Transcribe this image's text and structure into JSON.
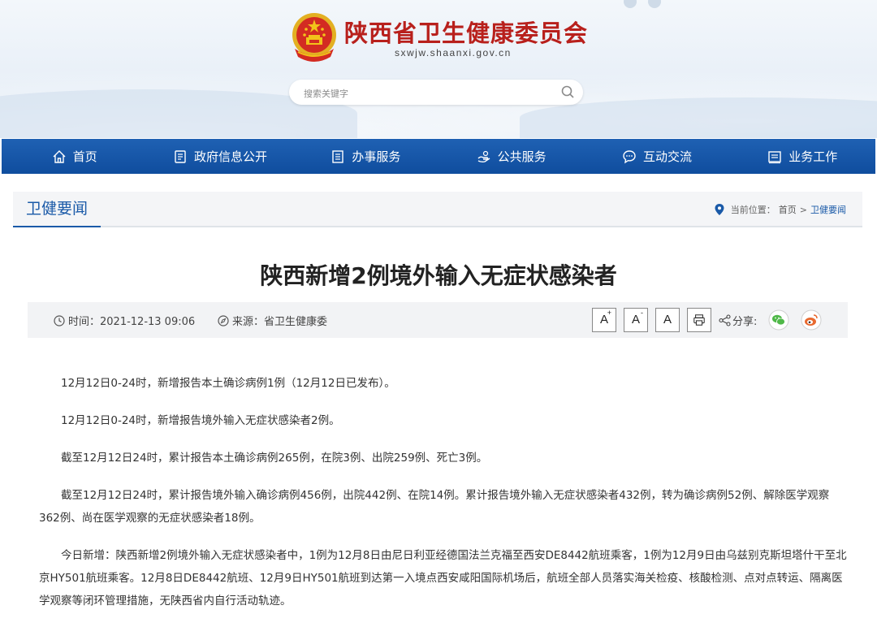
{
  "header": {
    "title": "陕西省卫生健康委员会",
    "url": "sxwjw.shaanxi.gov.cn",
    "search_placeholder": "搜索关键字"
  },
  "nav": {
    "items": [
      {
        "label": "首页",
        "icon": "home-icon"
      },
      {
        "label": "政府信息公开",
        "icon": "document-icon"
      },
      {
        "label": "办事服务",
        "icon": "list-icon"
      },
      {
        "label": "公共服务",
        "icon": "service-icon"
      },
      {
        "label": "互动交流",
        "icon": "chat-icon"
      },
      {
        "label": "业务工作",
        "icon": "briefcase-icon"
      }
    ]
  },
  "section": {
    "title": "卫健要闻",
    "breadcrumb_label": "当前位置：",
    "breadcrumb_home": "首页",
    "breadcrumb_sep": ">",
    "breadcrumb_current": "卫健要闻"
  },
  "article": {
    "title": "陕西新增2例境外输入无症状感染者",
    "time_label": "时间：2021-12-13 09:06",
    "source_label": "来源：省卫生健康委",
    "share_label": "分享:",
    "font_buttons": {
      "increase": "A",
      "decrease": "A",
      "reset": "A",
      "inc_mark": "+",
      "dec_mark": "-"
    },
    "paragraphs": [
      "12月12日0-24时，新增报告本土确诊病例1例（12月12日已发布）。",
      "12月12日0-24时，新增报告境外输入无症状感染者2例。",
      "截至12月12日24时，累计报告本土确诊病例265例，在院3例、出院259例、死亡3例。",
      "截至12月12日24时，累计报告境外输入确诊病例456例，出院442例、在院14例。累计报告境外输入无症状感染者432例，转为确诊病例52例、解除医学观察362例、尚在医学观察的无症状感染者18例。",
      "今日新增：陕西新增2例境外输入无症状感染者中，1例为12月8日由尼日利亚经德国法兰克福至西安DE8442航班乘客，1例为12月9日由乌兹别克斯坦塔什干至北京HY501航班乘客。12月8日DE8442航班、12月9日HY501航班到达第一入境点西安咸阳国际机场后，航班全部人员落实海关检疫、核酸检测、点对点转运、隔离医学观察等闭环管理措施，无陕西省内自行活动轨迹。"
    ]
  },
  "colors": {
    "nav_bg": "#1a5aa8",
    "title_red": "#b8201c",
    "wechat": "#4fb848",
    "weibo": "#e8692f"
  }
}
